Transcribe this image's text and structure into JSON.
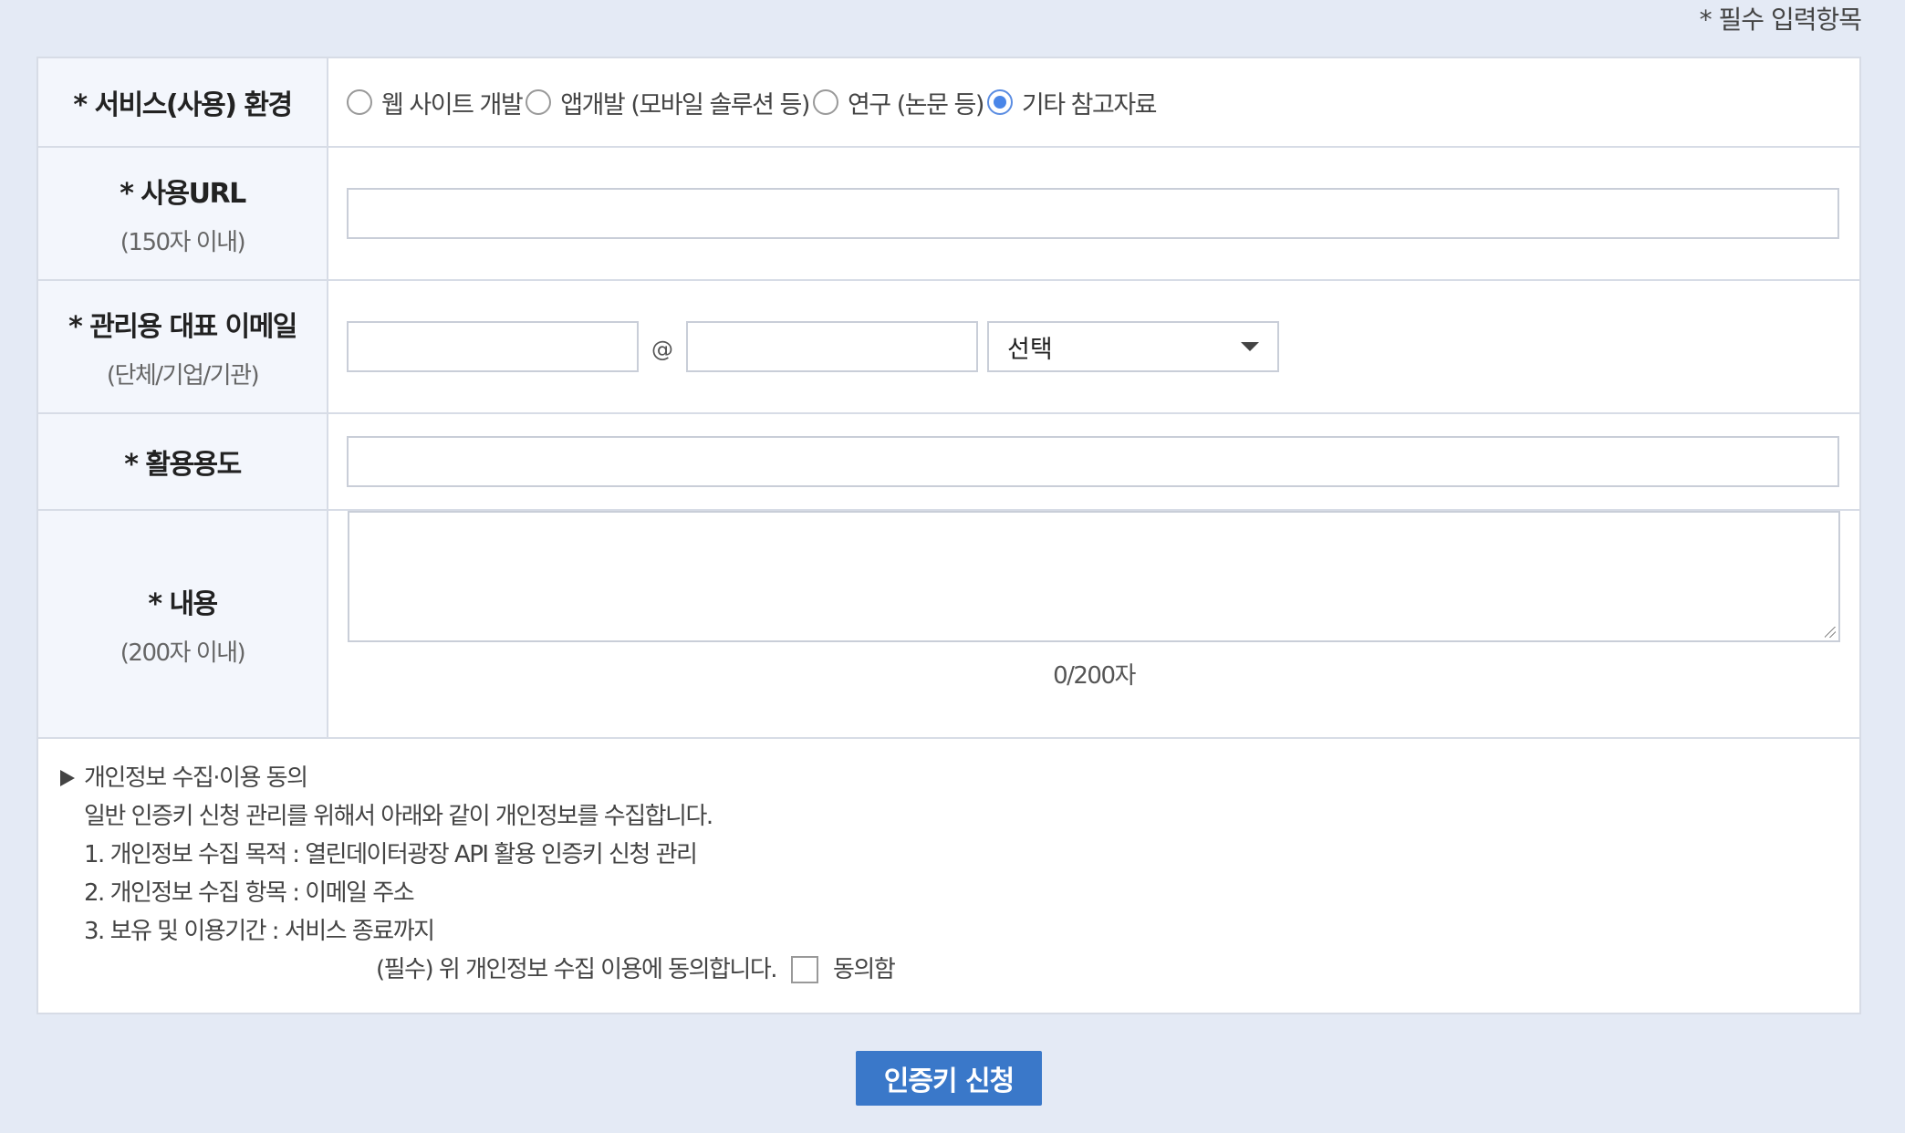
{
  "required_note": "* 필수 입력항목",
  "env": {
    "label": "* 서비스(사용) 환경",
    "options": [
      "웹 사이트 개발",
      "앱개발 (모바일 솔루션 등)",
      "연구 (논문 등)",
      "기타 참고자료"
    ],
    "selected": "기타 참고자료"
  },
  "url": {
    "label": "* 사용URL",
    "sub": "(150자 이내)",
    "value": ""
  },
  "email": {
    "label": "* 관리용 대표 이메일",
    "sub": "(단체/기업/기관)",
    "local_value": "",
    "at": "@",
    "domain_value": "",
    "select_value": "선택"
  },
  "usage": {
    "label": "* 활용용도",
    "value": ""
  },
  "content": {
    "label": "* 내용",
    "sub": "(200자 이내)",
    "value": "",
    "counter": "0/200자"
  },
  "privacy": {
    "title": "개인정보 수집·이용 동의",
    "intro": "일반 인증키 신청 관리를 위해서 아래와 같이 개인정보를 수집합니다.",
    "item1": "1. 개인정보 수집 목적 : 열린데이터광장 API 활용 인증키 신청 관리",
    "item2": "2. 개인정보 수집 항목 : 이메일 주소",
    "item3": "3. 보유 및 이용기간 : 서비스 종료까지",
    "agree_text": "(필수) 위 개인정보 수집 이용에 동의합니다.",
    "agree_label": "동의함",
    "agreed": false
  },
  "submit_label": "인증키 신청"
}
